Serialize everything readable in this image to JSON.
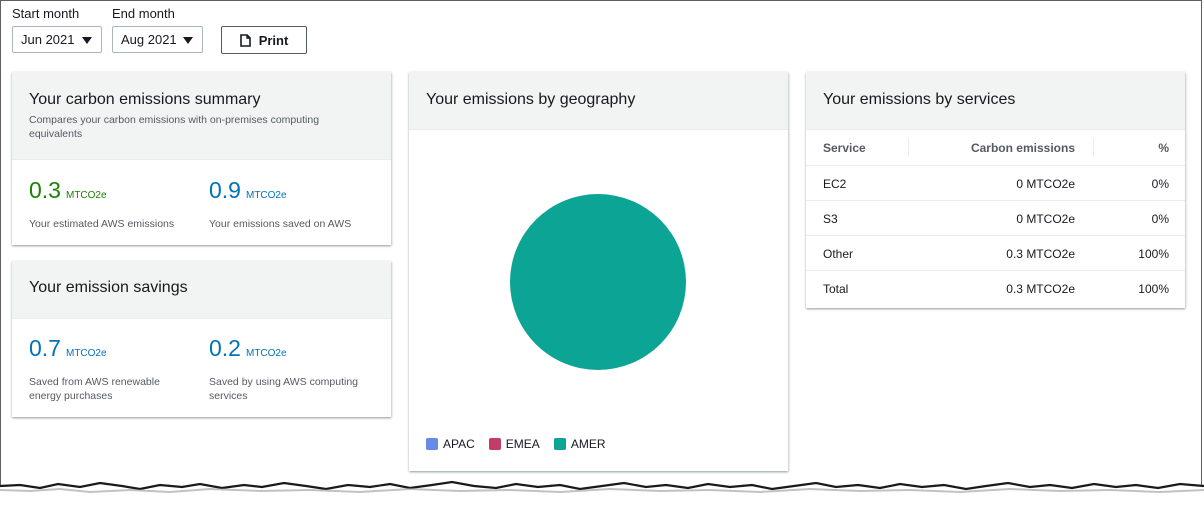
{
  "toolbar": {
    "start_label": "Start month",
    "start_value": "Jun 2021",
    "end_label": "End month",
    "end_value": "Aug 2021",
    "print_label": "Print"
  },
  "summary": {
    "title": "Your carbon emissions summary",
    "subtitle": "Compares your carbon emissions with on-premises computing equivalents",
    "metrics": [
      {
        "value": "0.3",
        "unit": "MTCO2e",
        "desc": "Your estimated AWS emissions"
      },
      {
        "value": "0.9",
        "unit": "MTCO2e",
        "desc": "Your emissions saved on AWS"
      }
    ]
  },
  "savings": {
    "title": "Your emission savings",
    "metrics": [
      {
        "value": "0.7",
        "unit": "MTCO2e",
        "desc": "Saved from AWS renewable energy purchases"
      },
      {
        "value": "0.2",
        "unit": "MTCO2e",
        "desc": "Saved by using AWS computing services"
      }
    ]
  },
  "geography": {
    "title": "Your emissions by geography",
    "legend": [
      {
        "label": "APAC",
        "color": "#688ae8"
      },
      {
        "label": "EMEA",
        "color": "#c33d69"
      },
      {
        "label": "AMER",
        "color": "#0ca495"
      }
    ]
  },
  "chart_data": {
    "type": "pie",
    "categories": [
      "APAC",
      "EMEA",
      "AMER"
    ],
    "values": [
      0,
      0,
      100
    ],
    "colors": [
      "#688ae8",
      "#c33d69",
      "#0ca495"
    ],
    "legend_position": "bottom-left"
  },
  "services": {
    "title": "Your emissions by services",
    "columns": [
      "Service",
      "Carbon emissions",
      "%"
    ],
    "rows": [
      [
        "EC2",
        "0 MTCO2e",
        "0%"
      ],
      [
        "S3",
        "0 MTCO2e",
        "0%"
      ],
      [
        "Other",
        "0.3 MTCO2e",
        "100%"
      ],
      [
        "Total",
        "0.3 MTCO2e",
        "100%"
      ]
    ]
  },
  "icons": {
    "print": "document-icon",
    "dropdown": "caret-down-icon"
  },
  "colors": {
    "green_metric": "#1d8102",
    "blue_metric": "#0073bb"
  }
}
